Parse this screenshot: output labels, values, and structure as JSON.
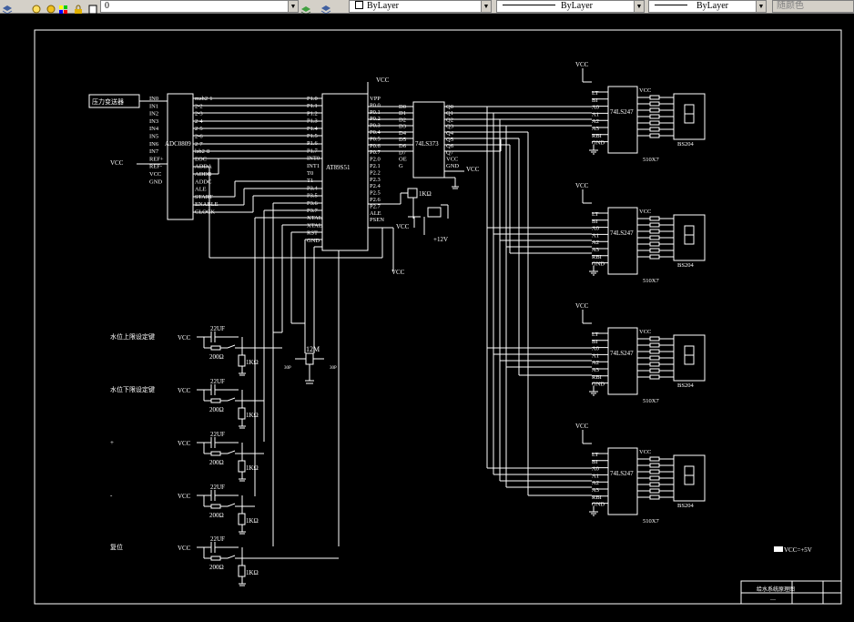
{
  "toolbar": {
    "layer_value": "0",
    "color_value": "ByLayer",
    "linetype_value": "ByLayer",
    "lineweight_value": "ByLayer",
    "plotstyle_value": "随颜色"
  },
  "drawing": {
    "sensor_label": "压力变送器",
    "adc": {
      "name": "ADC0809",
      "left_pins": [
        "IN0",
        "IN1",
        "IN2",
        "IN3",
        "IN4",
        "IN5",
        "IN6",
        "IN7",
        "REF+",
        "REF-",
        "VCC",
        "GND"
      ],
      "right_pins": [
        "msb2-1",
        "2-2",
        "2-3",
        "2-4",
        "2-5",
        "2-6",
        "2-7",
        "lsb2-8",
        "EOC",
        "ADDA",
        "ADDB",
        "ADDC",
        "ALE",
        "START",
        "ENABLE",
        "CLOCK"
      ]
    },
    "mcu": {
      "name": "AT89S51",
      "left_pins": [
        "P1.0",
        "P1.1",
        "P1.2",
        "P1.3",
        "P1.4",
        "P1.5",
        "P1.6",
        "P1.7",
        "INT0",
        "INT1",
        "T0",
        "T1",
        "P3.4",
        "P3.5",
        "P3.6",
        "P3.7",
        "XTAL",
        "XTAL",
        "RST",
        "GND"
      ],
      "right_pins": [
        "VPP",
        "P0.0",
        "P0.1",
        "P0.2",
        "P0.3",
        "P0.4",
        "P0.5",
        "P0.6",
        "P0.7",
        "P2.0",
        "P2.1",
        "P2.2",
        "P2.3",
        "P2.4",
        "P2.5",
        "P2.6",
        "P2.7",
        "ALE",
        "PSEN"
      ]
    },
    "latch": {
      "name": "74LS373",
      "left_pins": [
        "D0",
        "D1",
        "D2",
        "D3",
        "D4",
        "D5",
        "D6",
        "D7",
        "OE",
        "G"
      ],
      "right_pins": [
        "Q0",
        "Q1",
        "Q2",
        "Q3",
        "Q4",
        "Q5",
        "Q6",
        "Q7",
        "VCC",
        "GND"
      ]
    },
    "decoder": {
      "name": "74LS247",
      "left_pins": [
        "LT",
        "BI",
        "A0",
        "A1",
        "A2",
        "A3",
        "RBI",
        "GND"
      ],
      "right_pin": "VCC"
    },
    "display_name": "BS204",
    "resistor_label": "510X7",
    "vcc": "VCC",
    "gnd": "G",
    "plus12": "+12V",
    "res_1k": "1KΩ",
    "crystal": "12M",
    "cap_30p": "30P",
    "buttons": [
      {
        "label": "水位上限设定键"
      },
      {
        "label": "水位下限设定键"
      },
      {
        "label": "+"
      },
      {
        "label": "-"
      },
      {
        "label": "复位"
      }
    ],
    "btn_cap": "22UF",
    "btn_r1": "200Ω",
    "btn_r2": "1KΩ",
    "legend": "VCC=+5V",
    "title_block": {
      "name": "给水系统原理图",
      "sub": "—"
    }
  }
}
